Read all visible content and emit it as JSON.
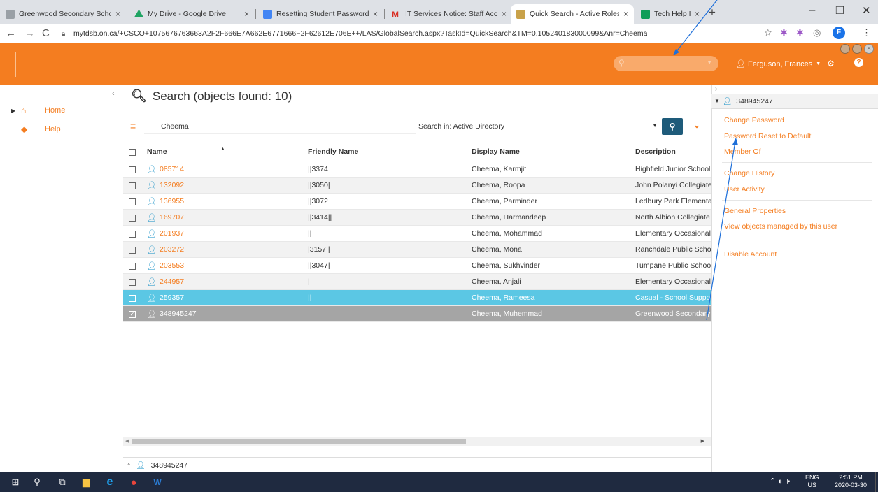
{
  "browser": {
    "tabs": [
      {
        "label": "Greenwood Secondary School",
        "icon": "school-icon",
        "color": "#9aa0a6"
      },
      {
        "label": "My Drive - Google Drive",
        "icon": "google-drive-icon",
        "color": "#1fa463"
      },
      {
        "label": "Resetting Student Passwords O",
        "icon": "google-docs-icon",
        "color": "#4285f4"
      },
      {
        "label": "IT Services Notice: Staff Access",
        "icon": "gmail-icon",
        "color": "#d93025"
      },
      {
        "label": "Quick Search - Active Roles We",
        "icon": "active-roles-icon",
        "color": "#c9a24a"
      },
      {
        "label": "Tech Help Index - Google Shee",
        "icon": "google-sheets-icon",
        "color": "#0f9d58"
      }
    ],
    "url": "mytdsb.on.ca/+CSCO+1075676763663A2F2F666E7A662E6771666F2F62612E706E++/LAS/GlobalSearch.aspx?TaskId=QuickSearch&TM=0.105240183000099&Anr=Cheema",
    "profile_initial": "F"
  },
  "header": {
    "user": "Ferguson, Frances",
    "accent": "#f47d20"
  },
  "leftnav": {
    "items": [
      {
        "label": "Home",
        "icon": "home-icon"
      },
      {
        "label": "Help",
        "icon": "tag-icon"
      }
    ]
  },
  "search": {
    "title": "Search (objects found: 10)",
    "query": "Cheema",
    "search_in": "Search in: Active Directory"
  },
  "table": {
    "columns": [
      "Name",
      "Friendly Name",
      "Display Name",
      "Description"
    ],
    "rows": [
      {
        "name": "085714",
        "friendly": "||3374",
        "display": "Cheema, Karmjit",
        "desc": "Highfield Junior School",
        "state": "normal"
      },
      {
        "name": "132092",
        "friendly": "||3050|",
        "display": "Cheema, Roopa",
        "desc": "John Polanyi Collegiate",
        "state": "alt"
      },
      {
        "name": "136955",
        "friendly": "||3072",
        "display": "Cheema, Parminder",
        "desc": "Ledbury Park Elementary",
        "state": "normal"
      },
      {
        "name": "169707",
        "friendly": "||3414||",
        "display": "Cheema, Harmandeep",
        "desc": "North Albion Collegiate",
        "state": "alt"
      },
      {
        "name": "201937",
        "friendly": "||",
        "display": "Cheema, Mohammad",
        "desc": "Elementary Occasional",
        "state": "normal"
      },
      {
        "name": "203272",
        "friendly": "|3157||",
        "display": "Cheema, Mona",
        "desc": "Ranchdale Public School",
        "state": "alt"
      },
      {
        "name": "203553",
        "friendly": "||3047|",
        "display": "Cheema, Sukhvinder",
        "desc": "Tumpane Public School",
        "state": "normal"
      },
      {
        "name": "244957",
        "friendly": "|",
        "display": "Cheema, Anjali",
        "desc": "Elementary Occasional",
        "state": "alt"
      },
      {
        "name": "259357",
        "friendly": "||",
        "display": "Cheema, Rameesa",
        "desc": "Casual - School Support",
        "state": "sel1"
      },
      {
        "name": "348945247",
        "friendly": "",
        "display": "Cheema, Muhemmad",
        "desc": "Greenwood Secondary",
        "state": "sel2",
        "checked": true
      }
    ]
  },
  "bottombar": {
    "selected": "348945247"
  },
  "rightpane": {
    "object": "348945247",
    "actions": [
      "Change Password",
      "Password Reset to Default",
      "Member Of",
      "Change History",
      "User Activity",
      "General Properties",
      "View objects managed by this user",
      "Disable Account"
    ]
  },
  "taskbar": {
    "lang": "ENG",
    "locale": "US",
    "time": "2:51 PM",
    "date": "2020-03-30"
  }
}
